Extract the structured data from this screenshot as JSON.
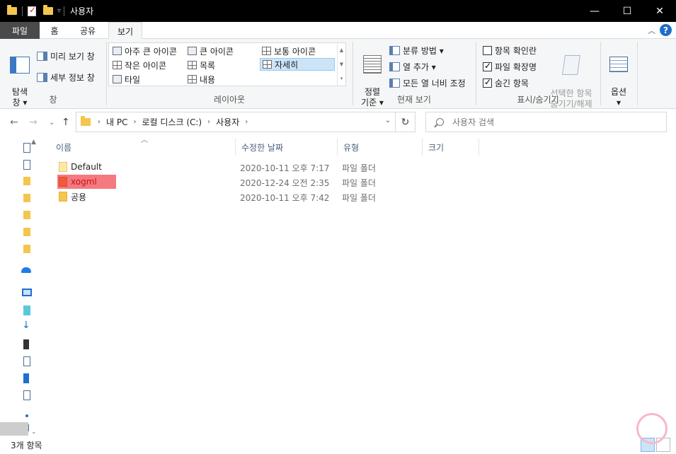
{
  "window": {
    "title": "사용자",
    "minimize": "—",
    "maximize": "☐",
    "close": "✕"
  },
  "tabs": {
    "file": "파일",
    "home": "홈",
    "share": "공유",
    "view": "보기"
  },
  "ribbon": {
    "panes": {
      "nav_pane_label": "탐색\n창 ▾",
      "preview_pane": "미리 보기 창",
      "details_pane": "세부 정보 창",
      "group_label": "창"
    },
    "layout": {
      "items": [
        "아주 큰 아이콘",
        "큰 아이콘",
        "보통 아이콘",
        "작은 아이콘",
        "목록",
        "자세히",
        "타일",
        "내용"
      ],
      "selected": "자세히",
      "group_label": "레이아웃"
    },
    "current_view": {
      "sort_by": "정렬\n기준 ▾",
      "group_by": "분류 방법 ▾",
      "add_columns": "열 추가 ▾",
      "size_all_columns": "모든 열 너비 조정",
      "group_label": "현재 보기"
    },
    "show_hide": {
      "item_checkboxes": {
        "label": "항목 확인란",
        "checked": false
      },
      "file_extensions": {
        "label": "파일 확장명",
        "checked": true
      },
      "hidden_items": {
        "label": "숨긴 항목",
        "checked": true
      },
      "hide_selected": "선택한 항목\n숨기기/해제",
      "group_label": "표시/숨기기"
    },
    "options": {
      "label": "옵션\n▾"
    }
  },
  "address": {
    "crumbs": [
      "내 PC",
      "로컬 디스크 (C:)",
      "사용자"
    ],
    "search_placeholder": "사용자 검색"
  },
  "columns": [
    "이름",
    "수정한 날짜",
    "유형",
    "크기"
  ],
  "files": [
    {
      "name": "Default",
      "modified": "2020-10-11 오후 7:17",
      "type": "파일 폴더",
      "highlighted": false
    },
    {
      "name": "xogml",
      "modified": "2020-12-24 오전 2:35",
      "type": "파일 폴더",
      "highlighted": true
    },
    {
      "name": "공용",
      "modified": "2020-10-11 오후 7:42",
      "type": "파일 폴더",
      "highlighted": false
    }
  ],
  "status": {
    "item_count": "3개 항목"
  },
  "colors": {
    "title_bar": "#000000",
    "file_tab": "#4a4a4a",
    "highlight": "#f47a80",
    "folder": "#f3c64d",
    "accent": "#1f6fc6"
  }
}
